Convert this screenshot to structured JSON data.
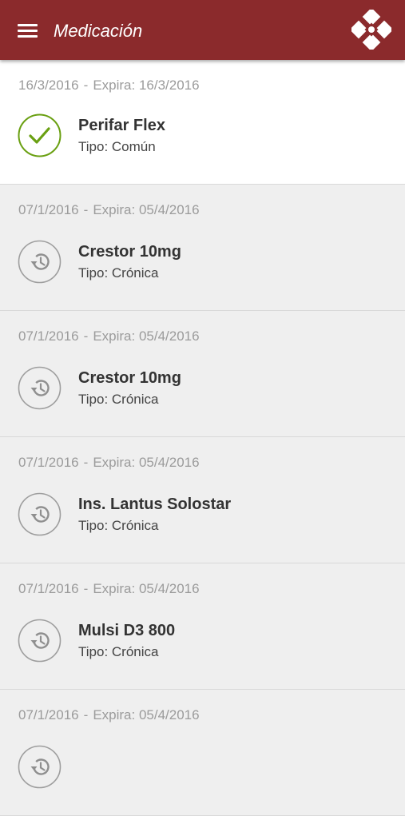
{
  "header": {
    "title": "Medicación",
    "menu_icon": "hamburger-menu-icon",
    "logo_icon": "diamond-logo-icon",
    "color": "#8b2a2c"
  },
  "medications": [
    {
      "start": "16/3/2016",
      "sep": "-",
      "expires": "Expira: 16/3/2016",
      "name": "Perifar Flex",
      "type": "Tipo: Común",
      "status_icon": "check-circle-icon",
      "active": true
    },
    {
      "start": "07/1/2016",
      "sep": "-",
      "expires": "Expira: 05/4/2016",
      "name": "Crestor 10mg",
      "type": "Tipo: Crónica",
      "status_icon": "history-icon",
      "active": false
    },
    {
      "start": "07/1/2016",
      "sep": "-",
      "expires": "Expira: 05/4/2016",
      "name": "Crestor 10mg",
      "type": "Tipo: Crónica",
      "status_icon": "history-icon",
      "active": false
    },
    {
      "start": "07/1/2016",
      "sep": "-",
      "expires": "Expira: 05/4/2016",
      "name": "Ins. Lantus Solostar",
      "type": "Tipo: Crónica",
      "status_icon": "history-icon",
      "active": false
    },
    {
      "start": "07/1/2016",
      "sep": "-",
      "expires": "Expira: 05/4/2016",
      "name": "Mulsi D3 800",
      "type": "Tipo: Crónica",
      "status_icon": "history-icon",
      "active": false
    },
    {
      "start": "07/1/2016",
      "sep": "-",
      "expires": "Expira: 05/4/2016",
      "name": "",
      "type": "",
      "status_icon": "history-icon",
      "active": false
    }
  ],
  "colors": {
    "check_green": "#6aa012",
    "history_gray": "#9e9e9e"
  }
}
